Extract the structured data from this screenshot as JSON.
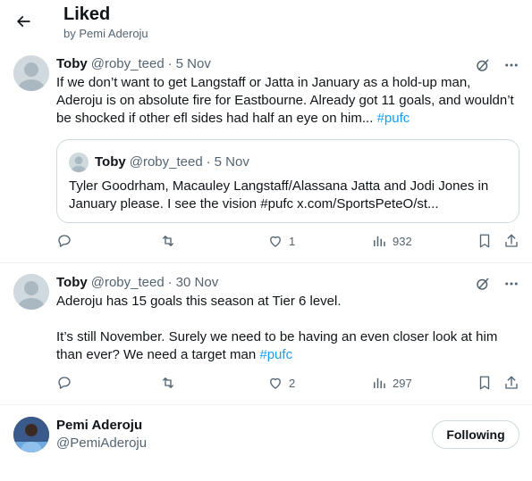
{
  "header": {
    "title": "Liked",
    "subtitle": "by Pemi Aderoju"
  },
  "tweets": [
    {
      "name": "Toby",
      "handle": "@roby_teed",
      "separator": "·",
      "date": "5 Nov",
      "text": "If we don’t want to get Langstaff or Jatta in January as a hold-up man, Aderoju is on absolute fire for Eastbourne. Already got 11 goals, and wouldn’t be shocked if other efl sides had half an eye on him...",
      "hashtag": "#pufc",
      "quote": {
        "name": "Toby",
        "handle": "@roby_teed",
        "separator": "·",
        "date": "5 Nov",
        "text": "Tyler Goodrham, Macauley Langstaff/Alassana Jatta and Jodi Jones in January please. I see the vision #pufc x.com/SportsPeteO/st..."
      },
      "likes": "1",
      "views": "932"
    },
    {
      "name": "Toby",
      "handle": "@roby_teed",
      "separator": "·",
      "date": "30 Nov",
      "text_line1": "Aderoju has 15 goals this season at Tier 6 level.",
      "text_line2": "It’s still November. Surely we need to be having an even closer look at him than ever? We need a target man",
      "hashtag": "#pufc",
      "likes": "2",
      "views": "297"
    }
  ],
  "user": {
    "name": "Pemi Aderoju",
    "handle": "@PemiAderoju",
    "follow_label": "Following"
  },
  "colors": {
    "accent": "#1d9bf0",
    "text": "#0f1419",
    "muted": "#536471",
    "border": "#eff3f4"
  }
}
